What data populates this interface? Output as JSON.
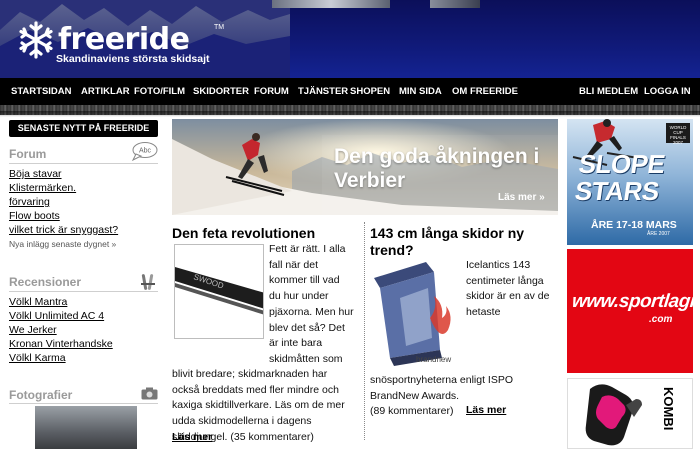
{
  "site": {
    "logo_text": "freeride",
    "trademark": "TM",
    "tagline": "Skandinaviens största skidsajt"
  },
  "nav": {
    "items": [
      {
        "label": "STARTSIDAN"
      },
      {
        "label": "ARTIKLAR"
      },
      {
        "label": "FOTO/FILM"
      },
      {
        "label": "SKIDORTER"
      },
      {
        "label": "FORUM"
      },
      {
        "label": "TJÄNSTER"
      },
      {
        "label": "SHOPEN"
      },
      {
        "label": "MIN SIDA"
      },
      {
        "label": "OM FREERIDE"
      }
    ],
    "right": [
      {
        "label": "BLI MEDLEM"
      },
      {
        "label": "LOGGA IN"
      }
    ]
  },
  "sidebar": {
    "news_button": "SENASTE NYTT PÅ FREERIDE",
    "forum": {
      "heading": "Forum",
      "icon": "speech-bubble-icon",
      "icon_text": "Abc",
      "links": [
        "Böja stavar",
        "Klistermärken.",
        "förvaring",
        "Flow boots",
        "vilket trick är snyggast?"
      ],
      "footer": "Nya inlägg senaste dygnet »"
    },
    "recensioner": {
      "heading": "Recensioner",
      "icon": "skis-icon",
      "links": [
        "Völkl Mantra",
        "Völkl Unlimited AC 4",
        "We Jerker",
        "Kronan Vinterhandske",
        "Völkl Karma"
      ]
    },
    "fotografier": {
      "heading": "Fotografier",
      "icon": "camera-icon"
    }
  },
  "hero": {
    "title": "Den goda åkningen i Verbier",
    "more": "Läs mer »"
  },
  "article1": {
    "title": "Den feta revolutionen",
    "image_text": "SWOOD",
    "body_lines": [
      "Fett är rätt. I alla",
      "fall när det",
      "kommer till vad",
      "du hur under",
      "pjäxorna. Men hur",
      "blev det så? Det",
      "är inte bara",
      "skidmåtten som"
    ],
    "body_full_lines": [
      "blivit bredare; skidmarknaden har",
      "också breddats med fler mindre och",
      "kaxiga skidtillverkare. Läs om de mer",
      "udda skidmodellerna i dagens",
      "skiddjungel. (35 kommentarer)"
    ],
    "more": "Läs mer"
  },
  "article2": {
    "title": "143 cm långa skidor ny trend?",
    "image_text": "brandnew",
    "body_lines": [
      "Icelantics 143",
      "centimeter långa",
      "skidor är en av de",
      "hetaste"
    ],
    "body_full_lines": [
      "snösportnyheterna enligt ISPO",
      "BrandNew Awards."
    ],
    "comments": "(89 kommentarer)",
    "more": "Läs mer"
  },
  "ads": {
    "slope": {
      "line1": "SLOPE",
      "line2": "STARS",
      "date": "ÅRE 17-18 MARS",
      "badge": "WORLD CUP FINALS 2007",
      "sponsor": "ÅRE 2007"
    },
    "sportlagret": {
      "text": "www.sportlagret",
      "com": ".com"
    },
    "kombi": {
      "text": "KOMBI"
    }
  },
  "colors": {
    "header_bg": "#0b0f5a",
    "nav_bg": "#000000",
    "ad_red": "#e30613"
  }
}
